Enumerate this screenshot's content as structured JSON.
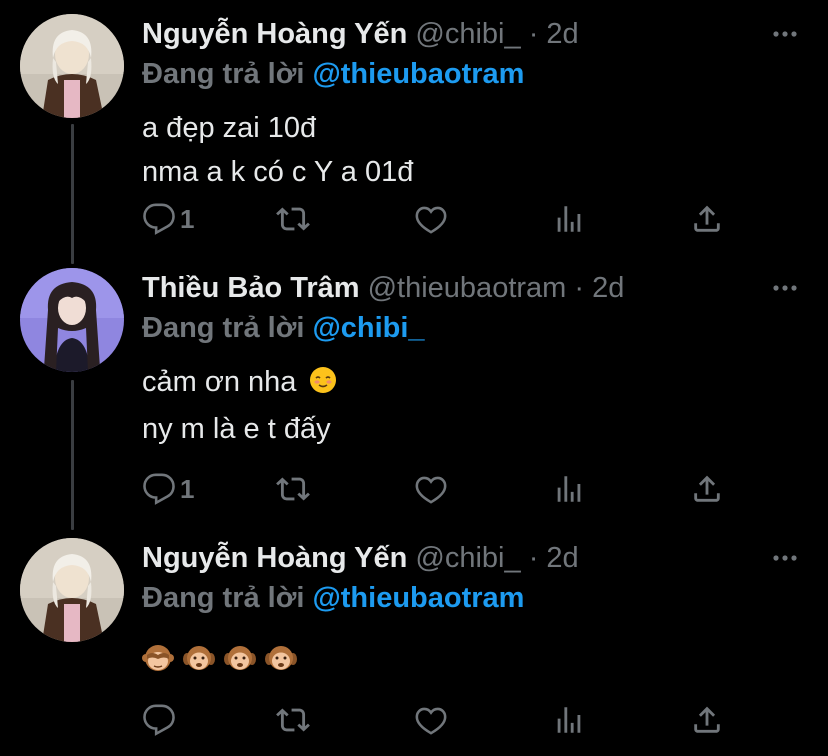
{
  "colors": {
    "background": "#000000",
    "text_primary": "#e7e9ea",
    "text_secondary": "#71767b",
    "accent": "#1d9bf0",
    "thread_line": "#3a3d41"
  },
  "tweets": [
    {
      "display_name": "Nguyễn Hoàng Yến",
      "handle": "@chibi_",
      "separator": "·",
      "time": "2d",
      "reply_prefix": "Đang trả lời",
      "reply_to": "@thieubaotram",
      "lines": [
        "a đẹp zai 10đ",
        "nma a k có c Y a 01đ"
      ],
      "reply_count": "1",
      "avatar_icon": "avatar-girl-brown-jacket"
    },
    {
      "display_name": "Thiều Bảo Trâm",
      "handle": "@thieubaotram",
      "separator": "·",
      "time": "2d",
      "reply_prefix": "Đang trả lời",
      "reply_to": "@chibi_",
      "lines": [
        "cảm ơn nha",
        "ny m là e t đấy"
      ],
      "line_emoji": "smiling-face-emoji",
      "reply_count": "1",
      "avatar_icon": "avatar-girl-purple-background"
    },
    {
      "display_name": "Nguyễn Hoàng Yến",
      "handle": "@chibi_",
      "separator": "·",
      "time": "2d",
      "reply_prefix": "Đang trả lời",
      "reply_to": "@thieubaotram",
      "emojis": [
        "see-no-evil-monkey",
        "hear-no-evil-monkey",
        "hear-no-evil-monkey",
        "hear-no-evil-monkey"
      ],
      "reply_count": "",
      "avatar_icon": "avatar-girl-brown-jacket"
    }
  ],
  "action_icons": [
    "reply-icon",
    "retweet-icon",
    "like-icon",
    "analytics-icon",
    "share-icon"
  ],
  "more_icon": "more-options-icon"
}
